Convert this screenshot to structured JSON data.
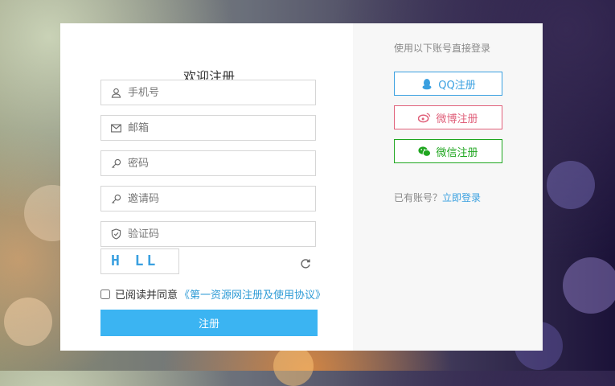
{
  "form": {
    "title": "欢迎注册",
    "fields": {
      "phone": {
        "placeholder": "手机号",
        "icon": "user-icon"
      },
      "email": {
        "placeholder": "邮箱",
        "icon": "mail-icon"
      },
      "password": {
        "placeholder": "密码",
        "icon": "key-icon"
      },
      "invite": {
        "placeholder": "邀请码",
        "icon": "key-icon"
      },
      "verify": {
        "placeholder": "验证码",
        "icon": "shield-icon"
      }
    },
    "captcha_text": "H LL",
    "agree_text": "已阅读并同意",
    "agree_link": "《第一资源网注册及使用协议》",
    "agree_checked": false,
    "submit_label": "注册"
  },
  "social": {
    "title": "使用以下账号直接登录",
    "qq_label": "QQ注册",
    "weibo_label": "微博注册",
    "wechat_label": "微信注册",
    "have_account_text": "已有账号？",
    "login_link": "立即登录"
  },
  "colors": {
    "primary": "#3bb4f2",
    "qq": "#3aa0e0",
    "weibo": "#e0607a",
    "wechat": "#1fa61f"
  }
}
